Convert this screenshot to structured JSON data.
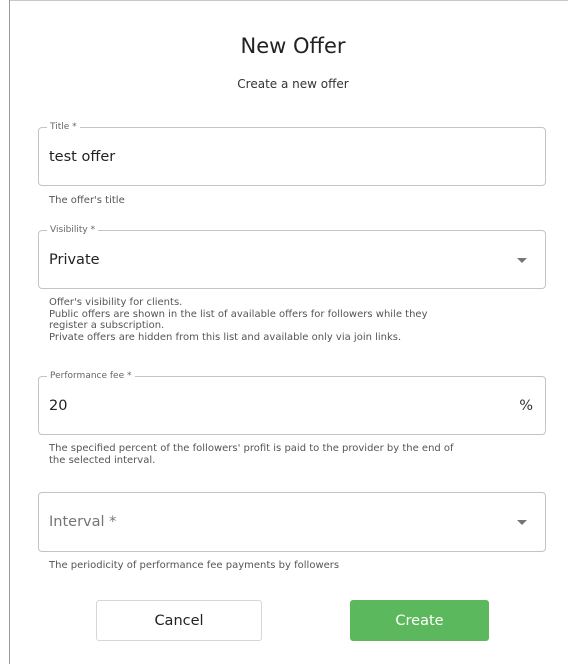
{
  "dialog": {
    "title": "New Offer",
    "subtitle": "Create a new offer"
  },
  "form": {
    "title_field": {
      "label": "Title *",
      "value": "test offer",
      "helper": "The offer's title"
    },
    "visibility_field": {
      "label": "Visibility *",
      "value": "Private",
      "helper_lines": [
        "Offer's visibility for clients.",
        "Public offers are shown in the list of available offers for followers while they",
        "register a subscription.",
        "Private offers are hidden from this list and available only via join links."
      ]
    },
    "performance_fee_field": {
      "label": "Performance fee *",
      "value": "20",
      "unit": "%",
      "helper_lines": [
        "The specified percent of the followers' profit is paid to the provider by the end of",
        "the selected interval."
      ]
    },
    "interval_field": {
      "placeholder": "Interval *",
      "helper": "The periodicity of performance fee payments by followers"
    }
  },
  "actions": {
    "cancel_label": "Cancel",
    "create_label": "Create"
  },
  "colors": {
    "create_button": "#5cb85c",
    "field_border": "#c4c4c4"
  }
}
